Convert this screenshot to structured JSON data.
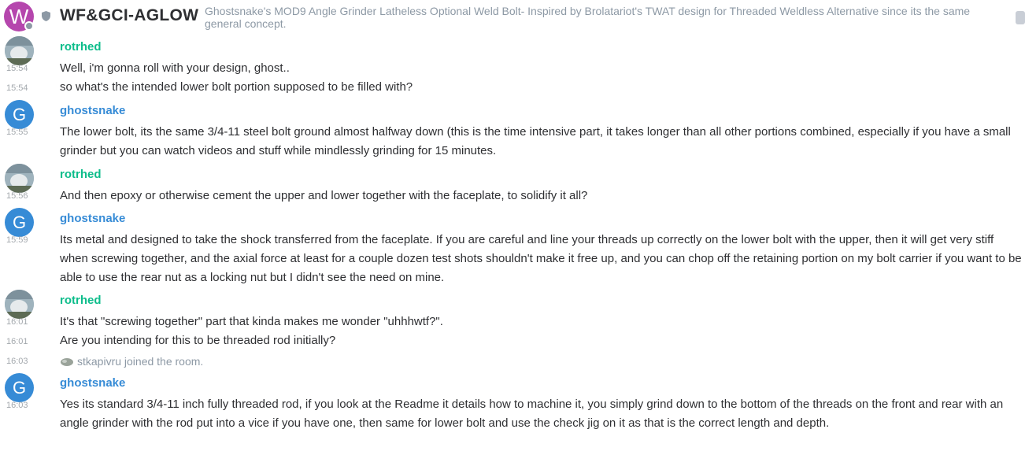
{
  "room": {
    "avatar_letter": "W",
    "name": "WF&GCI-AGLOW",
    "topic": "Ghostsnake's MOD9 Angle Grinder Latheless Optional Weld Bolt- Inspired by Brolatariot's TWAT design for Threaded Weldless Alternative since its the same general concept."
  },
  "users": {
    "rotrhed": "rotrhed",
    "ghostsnake": "ghostsnake",
    "ghost_avatar_letter": "G"
  },
  "messages": [
    {
      "time": "15:54",
      "text": "Well, i'm gonna roll with your design, ghost.."
    },
    {
      "time": "15:54",
      "text": "so what's the intended lower bolt portion supposed to be filled with?"
    },
    {
      "time": "15:55",
      "text": "The lower bolt, its the same 3/4-11 steel bolt ground almost halfway down (this is the time intensive part, it takes longer than all other portions combined, especially if you have a small grinder but you can watch videos and stuff while mindlessly grinding for 15 minutes."
    },
    {
      "time": "15:56",
      "text": "And then epoxy or otherwise cement the upper and lower together with the faceplate, to solidify it all?"
    },
    {
      "time": "15:59",
      "text": "Its metal and designed to take the shock transferred from the faceplate.  If you are careful and line your threads up correctly on the lower bolt with the upper, then it will get very stiff when screwing together, and the axial force at least for a couple dozen test shots shouldn't make it free up, and you can chop off the retaining portion on my bolt carrier if you want to be able to use the rear nut as a locking nut but I didn't see the need on mine."
    },
    {
      "time": "16:01",
      "text": "It's that \"screwing together\" part that kinda makes me wonder \"uhhhwtf?\"."
    },
    {
      "time": "16:01",
      "text": "Are you intending for this to be threaded rod initially?"
    },
    {
      "time": "16:03",
      "text": "stkapivru joined the room."
    },
    {
      "time": "16:03",
      "text": "Yes its standard 3/4-11 inch fully threaded rod, if you look at the Readme it details how to machine it, you simply grind down to the bottom of the threads on the front and rear with an angle grinder with the rod put into a vice if you have one, then same for lower bolt and use the check jig on it as that is the correct length and depth."
    }
  ],
  "colors": {
    "room_avatar": "#b546ad",
    "ghost_name": "#368bd6",
    "rotrhed_name": "#0dbd8b"
  },
  "icons": [
    "shield-icon",
    "join-avatar-icon"
  ]
}
